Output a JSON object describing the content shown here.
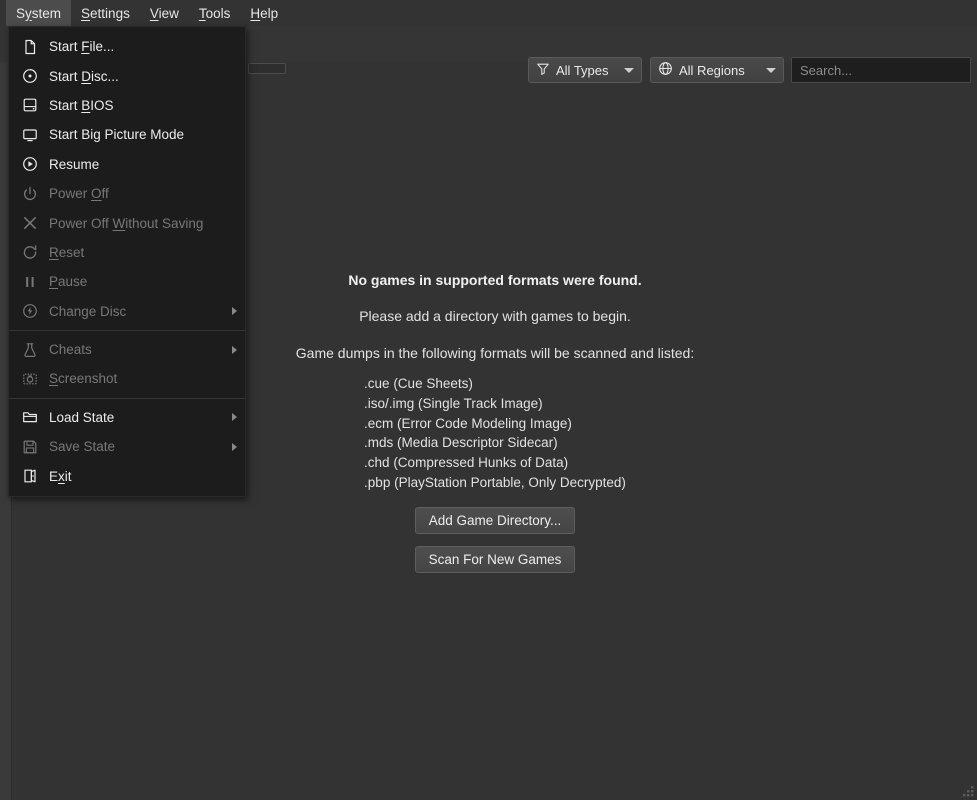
{
  "menubar": {
    "items": [
      {
        "name": "system",
        "pre": "S",
        "mnemonic": "y",
        "post": "stem",
        "active": true
      },
      {
        "name": "settings",
        "pre": "",
        "mnemonic": "S",
        "post": "ettings",
        "active": false
      },
      {
        "name": "view",
        "pre": "",
        "mnemonic": "V",
        "post": "iew",
        "active": false
      },
      {
        "name": "tools",
        "pre": "",
        "mnemonic": "T",
        "post": "ools",
        "active": false
      },
      {
        "name": "help",
        "pre": "",
        "mnemonic": "H",
        "post": "elp",
        "active": false
      }
    ]
  },
  "toolbar": {
    "all_types_label": "All Types",
    "all_types_icon": "filter-icon",
    "all_regions_label": "All Regions",
    "all_regions_icon": "globe-icon",
    "search": {
      "placeholder": "Search...",
      "value": ""
    }
  },
  "system_menu": {
    "items": [
      {
        "type": "item",
        "icon": "file-icon",
        "pre": "Start ",
        "mnemonic": "F",
        "post": "ile...",
        "disabled": false,
        "submenu": false,
        "name": "start-file"
      },
      {
        "type": "item",
        "icon": "disc-icon",
        "pre": "Start ",
        "mnemonic": "D",
        "post": "isc...",
        "disabled": false,
        "submenu": false,
        "name": "start-disc"
      },
      {
        "type": "item",
        "icon": "bios-chip-icon",
        "pre": "Start ",
        "mnemonic": "B",
        "post": "IOS",
        "disabled": false,
        "submenu": false,
        "name": "start-bios"
      },
      {
        "type": "item",
        "icon": "monitor-icon",
        "pre": "Start Big Picture Mode",
        "mnemonic": "",
        "post": "",
        "disabled": false,
        "submenu": false,
        "name": "start-big-picture-mode"
      },
      {
        "type": "item",
        "icon": "play-circle-icon",
        "pre": "Resume",
        "mnemonic": "",
        "post": "",
        "disabled": false,
        "submenu": false,
        "name": "resume"
      },
      {
        "type": "item",
        "icon": "power-icon",
        "pre": "Power ",
        "mnemonic": "O",
        "post": "ff",
        "disabled": true,
        "submenu": false,
        "name": "power-off"
      },
      {
        "type": "item",
        "icon": "close-x-icon",
        "pre": "Power Off ",
        "mnemonic": "W",
        "post": "ithout Saving",
        "disabled": true,
        "submenu": false,
        "name": "power-off-without-saving"
      },
      {
        "type": "item",
        "icon": "reset-icon",
        "pre": "",
        "mnemonic": "R",
        "post": "eset",
        "disabled": true,
        "submenu": false,
        "name": "reset"
      },
      {
        "type": "item",
        "icon": "pause-icon",
        "pre": "",
        "mnemonic": "P",
        "post": "ause",
        "disabled": true,
        "submenu": false,
        "name": "pause"
      },
      {
        "type": "item",
        "icon": "change-disc-icon",
        "pre": "Change Disc",
        "mnemonic": "",
        "post": "",
        "disabled": true,
        "submenu": true,
        "name": "change-disc"
      },
      {
        "type": "sep",
        "name": "menu-separator-1"
      },
      {
        "type": "item",
        "icon": "flask-icon",
        "pre": "Cheats",
        "mnemonic": "",
        "post": "",
        "disabled": true,
        "submenu": true,
        "name": "cheats"
      },
      {
        "type": "item",
        "icon": "camera-icon",
        "pre": "",
        "mnemonic": "S",
        "post": "creenshot",
        "disabled": true,
        "submenu": false,
        "name": "screenshot"
      },
      {
        "type": "sep",
        "name": "menu-separator-2"
      },
      {
        "type": "item",
        "icon": "folder-open-icon",
        "pre": "Load State",
        "mnemonic": "",
        "post": "",
        "disabled": false,
        "submenu": true,
        "name": "load-state"
      },
      {
        "type": "item",
        "icon": "save-disk-icon",
        "pre": "Save State",
        "mnemonic": "",
        "post": "",
        "disabled": true,
        "submenu": true,
        "name": "save-state"
      },
      {
        "type": "item",
        "icon": "exit-door-icon",
        "pre": "E",
        "mnemonic": "x",
        "post": "it",
        "disabled": false,
        "submenu": false,
        "name": "exit"
      }
    ]
  },
  "empty_state": {
    "title": "No games in supported formats were found.",
    "subtitle": "Please add a directory with games to begin.",
    "formats_intro": "Game dumps in the following formats will be scanned and listed:",
    "formats": [
      ".cue (Cue Sheets)",
      ".iso/.img (Single Track Image)",
      ".ecm (Error Code Modeling Image)",
      ".mds (Media Descriptor Sidecar)",
      ".chd (Compressed Hunks of Data)",
      ".pbp (PlayStation Portable, Only Decrypted)"
    ],
    "add_directory_label": "Add Game Directory...",
    "scan_games_label": "Scan For New Games"
  },
  "colors": {
    "window_bg": "#333333",
    "menubar_bg": "#333333",
    "menubar_active": "#4c4c4c",
    "popup_bg": "#1c1c1c",
    "text": "#ececec",
    "text_disabled": "#787878",
    "search_bg": "#1e1e1e",
    "button_face": "#4a4a4a"
  }
}
